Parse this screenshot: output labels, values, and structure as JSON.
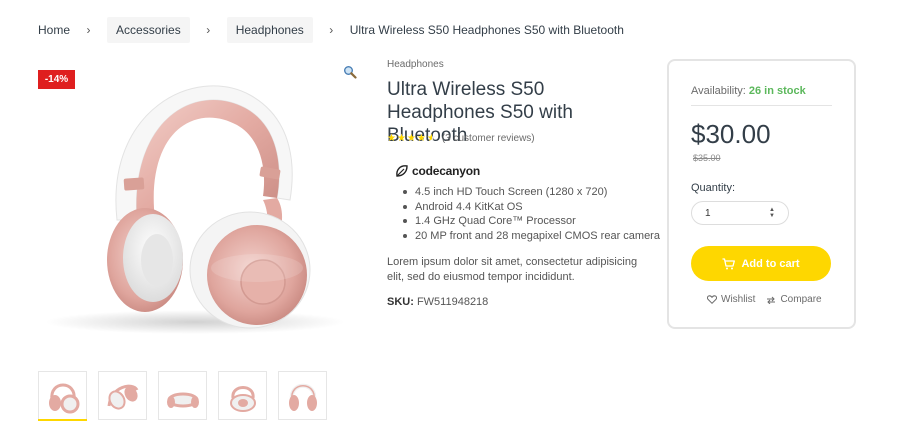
{
  "breadcrumb": {
    "home": "Home",
    "accessories": "Accessories",
    "headphones": "Headphones",
    "current": "Ultra Wireless S50 Headphones S50 with Bluetooth",
    "separator": "›"
  },
  "gallery": {
    "sale_badge": "-14%",
    "zoom_icon": "magnifier-icon",
    "thumbnail_count": 5,
    "active_thumbnail": 1
  },
  "product": {
    "category": "Headphones",
    "title": "Ultra Wireless S50 Headphones S50 with Bluetooth",
    "rating": 4.5,
    "rating_max": 5,
    "reviews_text": "(3 customer reviews)",
    "brand": "codecanyon",
    "features": [
      "4.5 inch HD Touch Screen (1280 x 720)",
      "Android 4.4 KitKat OS",
      "1.4 GHz Quad Core™ Processor",
      "20 MP front and 28 megapixel CMOS rear camera"
    ],
    "description": "Lorem ipsum dolor sit amet, consectetur adipisicing elit, sed do eiusmod tempor incididunt.",
    "sku_label": "SKU:",
    "sku_value": "FW511948218"
  },
  "purchase": {
    "availability_label": "Availability:",
    "availability_value": "26 in stock",
    "price": "$30.00",
    "old_price": "$35.00",
    "quantity_label": "Quantity:",
    "quantity_value": "1",
    "add_to_cart": "Add to cart",
    "wishlist": "Wishlist",
    "compare": "Compare"
  },
  "colors": {
    "accent": "#fed700",
    "sale": "#df1f1f",
    "in_stock": "#5cb85c",
    "headphone_rose": "#e8b4ad",
    "text": "#333e48"
  }
}
